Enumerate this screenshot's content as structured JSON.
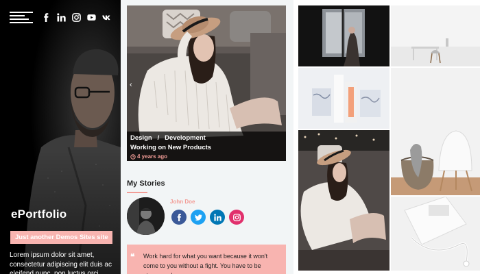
{
  "sidebar": {
    "site_title": "ePortfolio",
    "tagline": "Just another Demos Sites site",
    "bio": "Lorem ipsum dolor sit amet, consectetur adipiscing elit duis ac eleifend nunc, non luctus orci",
    "menu_icon": "hamburger-menu-icon",
    "socials": [
      "facebook-icon",
      "linkedin-icon",
      "instagram-icon",
      "youtube-icon",
      "vk-icon"
    ]
  },
  "hero": {
    "cat1": "Design",
    "separator": "/",
    "cat2": "Development",
    "title": "Working on New Products",
    "time": "4 years ago",
    "prev_icon": "chevron-left-icon",
    "clock_icon": "clock-icon"
  },
  "stories": {
    "heading": "My Stories",
    "author": "John Doe",
    "socials": [
      "facebook-icon",
      "twitter-icon",
      "linkedin-icon",
      "instagram-icon"
    ],
    "quote_icon": "quote-icon",
    "quote": "Work hard for what you want because it won't come to you without a fight. You have to be strong and"
  },
  "colors": {
    "accent": "#f8b4b0",
    "accent_dark": "#f29d97",
    "facebook": "#3b5998",
    "twitter": "#1da1f2",
    "linkedin": "#0077b5",
    "instagram": "#e1306c",
    "center_bg": "#f2f5f6"
  }
}
